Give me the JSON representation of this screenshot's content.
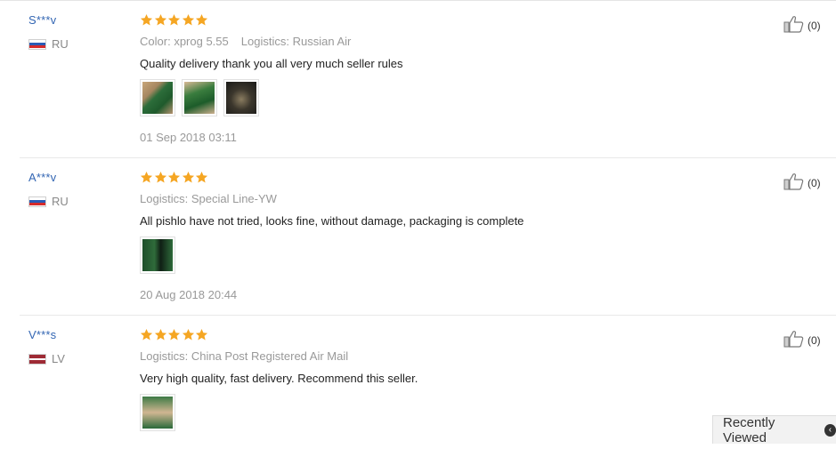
{
  "reviews": [
    {
      "user": "S***v",
      "country": "RU",
      "flag_colors": [
        "#ffffff",
        "#2a5bb6",
        "#d62b2b"
      ],
      "rating": 5,
      "meta": [
        {
          "label": "Color:",
          "value": "xprog 5.55"
        },
        {
          "label": "Logistics:",
          "value": "Russian Air"
        }
      ],
      "text": "Quality delivery thank you all very much seller rules",
      "photos": [
        "board-photo",
        "board-photo",
        "board-photo"
      ],
      "date": "01 Sep 2018 03:11",
      "likes": "(0)"
    },
    {
      "user": "A***v",
      "country": "RU",
      "flag_colors": [
        "#ffffff",
        "#2a5bb6",
        "#d62b2b"
      ],
      "rating": 5,
      "meta": [
        {
          "label": "Logistics:",
          "value": "Special Line-YW"
        }
      ],
      "text": "All pishlo have not tried, looks fine, without damage, packaging is complete",
      "photos": [
        "board-photo"
      ],
      "date": "20 Aug 2018 20:44",
      "likes": "(0)"
    },
    {
      "user": "V***s",
      "country": "LV",
      "flag_colors": [
        "#9e2a35",
        "#ffffff",
        "#9e2a35"
      ],
      "rating": 5,
      "meta": [
        {
          "label": "Logistics:",
          "value": "China Post Registered Air Mail"
        }
      ],
      "text": "Very high quality, fast delivery. Recommend this seller.",
      "photos": [
        "board-photo"
      ],
      "date": "",
      "likes": "(0)"
    }
  ],
  "recently_viewed": {
    "label": "Recently Viewed",
    "icon": "chevron-circle-icon"
  },
  "colors": {
    "star": "#f5a623",
    "username": "#3366b3",
    "muted": "#999999"
  }
}
